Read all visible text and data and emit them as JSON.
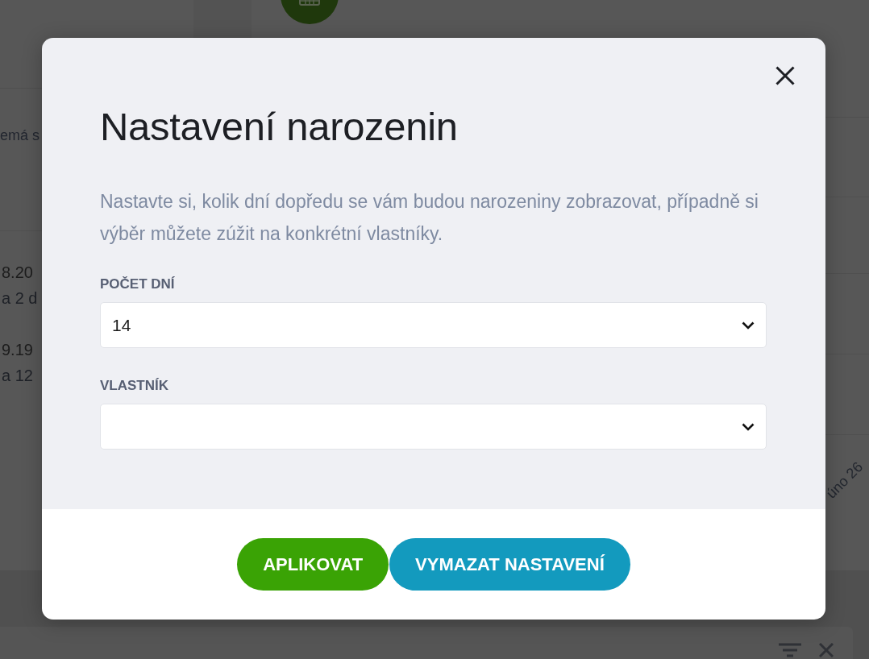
{
  "background_page": {
    "subject": "emá s",
    "entries": [
      {
        "date": "8.20",
        "note": "a 2 d"
      },
      {
        "date": "9.19",
        "note": "a 12"
      }
    ],
    "axis_label": "úno 26"
  },
  "dialog": {
    "title": "Nastavení narozenin",
    "description": "Nastavte si, kolik dní dopředu se vám budou narozeniny zobrazovat, případně si výběr můžete zúžit na konkrétní vlastníky.",
    "fields": [
      {
        "label": "POČET DNÍ",
        "value": "14"
      },
      {
        "label": "VLASTNÍK"
      }
    ],
    "buttons": [
      {
        "label": "APLIKOVAT",
        "kind": "primary"
      },
      {
        "label": "VYMAZAT NASTAVENÍ",
        "kind": "secondary"
      }
    ]
  }
}
